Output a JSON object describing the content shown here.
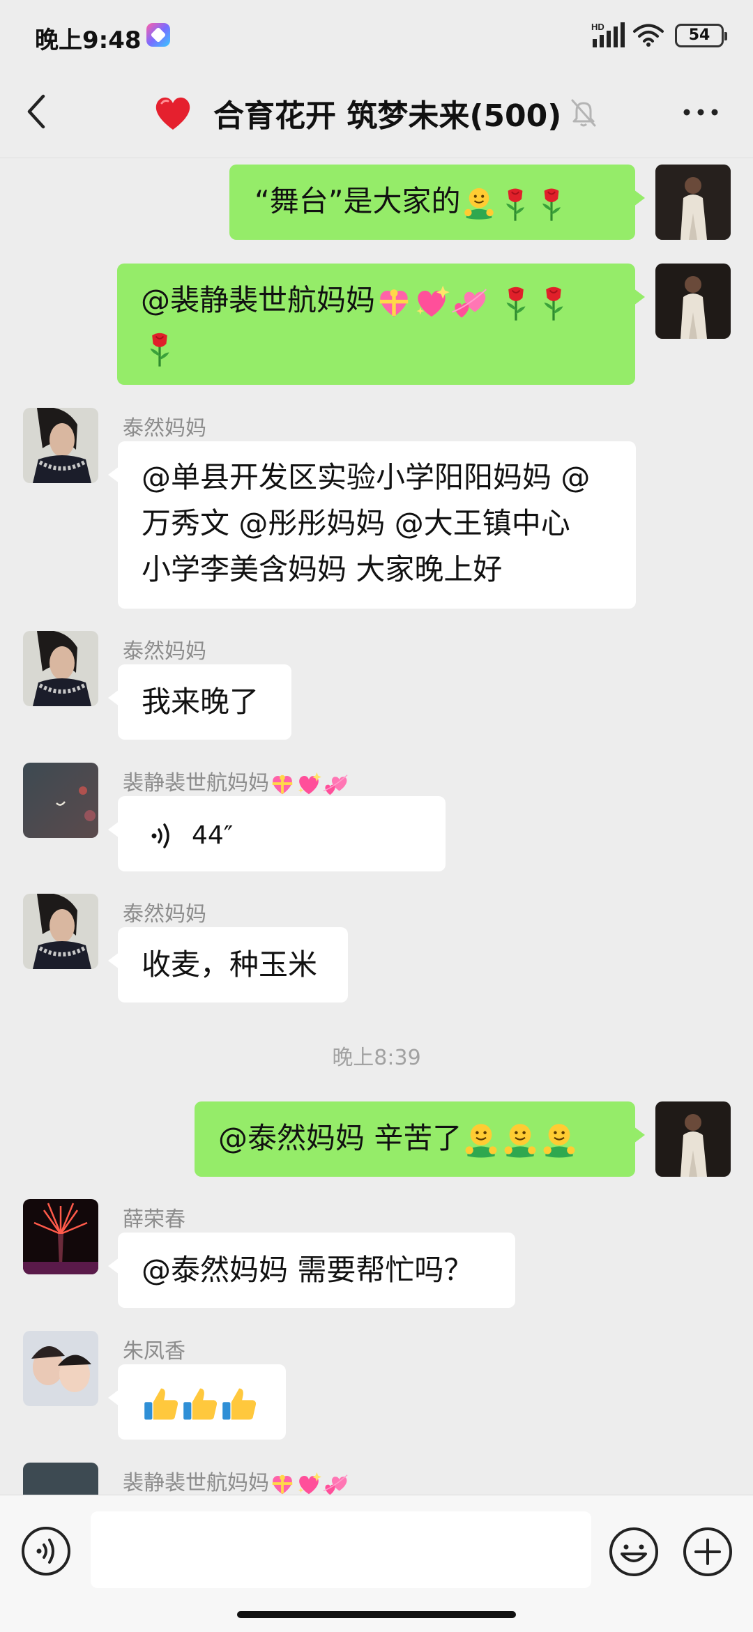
{
  "status_bar": {
    "time": "晚上9:48",
    "network": "HD",
    "battery": "54"
  },
  "header": {
    "title": "合育花开 筑梦未来(500)"
  },
  "messages": [
    {
      "side": "out",
      "text": "“舞台”是大家的"
    },
    {
      "side": "out",
      "text": "@裴静裴世航妈妈"
    },
    {
      "side": "in",
      "sender": "泰然妈妈",
      "lines": [
        "@单县开发区实验小学阳阳妈妈 @",
        "万秀文 @彤彤妈妈 @大王镇中心",
        "小学李美含妈妈  大家晚上好"
      ]
    },
    {
      "side": "in",
      "sender": "泰然妈妈",
      "text": "我来晚了"
    },
    {
      "side": "in",
      "sender": "裴静裴世航妈妈",
      "voice_duration": "44″"
    },
    {
      "side": "in",
      "sender": "泰然妈妈",
      "text": "收麦，种玉米"
    },
    {
      "side": "out",
      "text": "@泰然妈妈  辛苦了"
    },
    {
      "side": "in",
      "sender": "薛荣春",
      "text": "@泰然妈妈  需要帮忙吗？"
    },
    {
      "side": "in",
      "sender": "朱凤香",
      "text": ""
    },
    {
      "side": "in",
      "sender": "裴静裴世航妈妈"
    }
  ],
  "time_separator": "晚上8:39",
  "composer": {
    "placeholder": ""
  },
  "colors": {
    "outgoing_bubble": "#95ec69",
    "incoming_bubble": "#ffffff",
    "background": "#ededed"
  },
  "icons": [
    "back-arrow",
    "heart",
    "mute-bell",
    "more-dots",
    "voice",
    "emoji",
    "plus",
    "hugging-face",
    "rose",
    "gift-heart",
    "sparkling-heart",
    "two-hearts",
    "thumbs-up"
  ]
}
